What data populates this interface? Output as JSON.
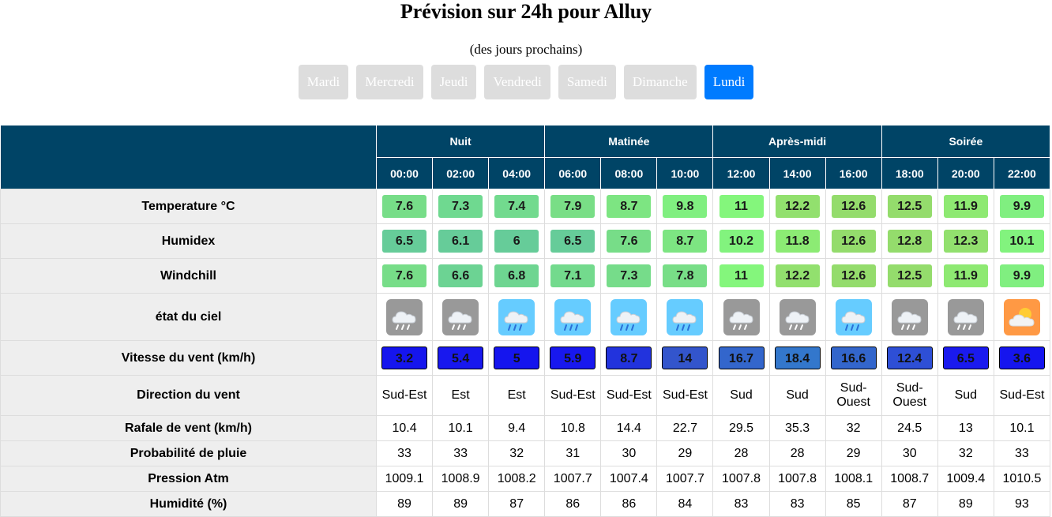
{
  "title": "Prévision sur 24h pour Alluy",
  "subtitle": "(des jours prochains)",
  "days": [
    {
      "label": "Mardi",
      "active": false
    },
    {
      "label": "Mercredi",
      "active": false
    },
    {
      "label": "Jeudi",
      "active": false
    },
    {
      "label": "Vendredi",
      "active": false
    },
    {
      "label": "Samedi",
      "active": false
    },
    {
      "label": "Dimanche",
      "active": false
    },
    {
      "label": "Lundi",
      "active": true
    }
  ],
  "colors": {
    "header_bg": "#004466",
    "active_tab": "#007bff",
    "inactive_tab": "#dddddd",
    "label_bg": "#eeeeee"
  },
  "periods": [
    "Nuit",
    "Matinée",
    "Après-midi",
    "Soirée"
  ],
  "hours": [
    "00:00",
    "02:00",
    "04:00",
    "06:00",
    "08:00",
    "10:00",
    "12:00",
    "14:00",
    "16:00",
    "18:00",
    "20:00",
    "22:00"
  ],
  "rows": {
    "temperature": {
      "label": "Temperature °C",
      "values": [
        "7.6",
        "7.3",
        "7.4",
        "7.9",
        "8.7",
        "9.8",
        "11",
        "12.2",
        "12.6",
        "12.5",
        "11.9",
        "9.9"
      ],
      "colors": [
        "#77dd88",
        "#6fd990",
        "#72da8e",
        "#79de86",
        "#7de582",
        "#80ef80",
        "#84f67c",
        "#92e06e",
        "#94dc6c",
        "#94dc6c",
        "#8ee972",
        "#80ef80"
      ]
    },
    "humidex": {
      "label": "Humidex",
      "values": [
        "6.5",
        "6.1",
        "6",
        "6.5",
        "7.6",
        "8.7",
        "10.2",
        "11.8",
        "12.6",
        "12.8",
        "12.3",
        "10.1"
      ],
      "colors": [
        "#66cc99",
        "#66cc99",
        "#66cc99",
        "#66cc99",
        "#77dd88",
        "#7de582",
        "#82f37e",
        "#8ceb74",
        "#94dc6c",
        "#94dc6c",
        "#92e06e",
        "#82f37e"
      ]
    },
    "windchill": {
      "label": "Windchill",
      "values": [
        "7.6",
        "6.6",
        "6.8",
        "7.1",
        "7.3",
        "7.8",
        "11",
        "12.2",
        "12.6",
        "12.5",
        "11.9",
        "9.9"
      ],
      "colors": [
        "#77dd88",
        "#6cd393",
        "#6ed591",
        "#73da8d",
        "#76dc8a",
        "#78de87",
        "#84f67c",
        "#92e06e",
        "#94dc6c",
        "#94dc6c",
        "#8ee972",
        "#80ef80"
      ]
    },
    "sky": {
      "label": "état du ciel",
      "icons": [
        "rain-cloud-gray-icon",
        "rain-cloud-gray-icon",
        "rain-cloud-blue-icon",
        "rain-cloud-blue-icon",
        "rain-cloud-blue-icon",
        "rain-cloud-blue-icon",
        "rain-cloud-gray-icon",
        "rain-cloud-gray-icon",
        "rain-cloud-blue-icon",
        "rain-cloud-gray-icon",
        "rain-cloud-gray-icon",
        "sun-cloud-icon"
      ]
    },
    "wind_speed": {
      "label": "Vitesse du vent (km/h)",
      "values": [
        "3.2",
        "5.4",
        "5",
        "5.9",
        "8.7",
        "14",
        "16.7",
        "18.4",
        "16.6",
        "12.4",
        "6.5",
        "3.6"
      ],
      "colors": [
        "#1515ee",
        "#1818ee",
        "#1515ee",
        "#1818ee",
        "#2233dd",
        "#3355cc",
        "#3366cc",
        "#3377cc",
        "#3366cc",
        "#2e4fd6",
        "#1a1aee",
        "#1515ee"
      ]
    },
    "wind_dir": {
      "label": "Direction du vent",
      "values": [
        "Sud-Est",
        "Est",
        "Est",
        "Sud-Est",
        "Sud-Est",
        "Sud-Est",
        "Sud",
        "Sud",
        "Sud-\nOuest",
        "Sud-\nOuest",
        "Sud",
        "Sud-Est"
      ]
    },
    "gust": {
      "label": "Rafale de vent (km/h)",
      "values": [
        "10.4",
        "10.1",
        "9.4",
        "10.8",
        "14.4",
        "22.7",
        "29.5",
        "35.3",
        "32",
        "24.5",
        "13",
        "10.1"
      ]
    },
    "rain_prob": {
      "label": "Probabilité de pluie",
      "values": [
        "33",
        "33",
        "32",
        "31",
        "30",
        "29",
        "28",
        "28",
        "29",
        "30",
        "32",
        "33"
      ]
    },
    "pressure": {
      "label": "Pression Atm",
      "values": [
        "1009.1",
        "1008.9",
        "1008.2",
        "1007.7",
        "1007.4",
        "1007.7",
        "1007.8",
        "1007.8",
        "1008.1",
        "1008.7",
        "1009.4",
        "1010.5"
      ]
    },
    "humidity": {
      "label": "Humidité (%)",
      "values": [
        "89",
        "89",
        "87",
        "86",
        "86",
        "84",
        "83",
        "83",
        "85",
        "87",
        "89",
        "93"
      ]
    }
  }
}
